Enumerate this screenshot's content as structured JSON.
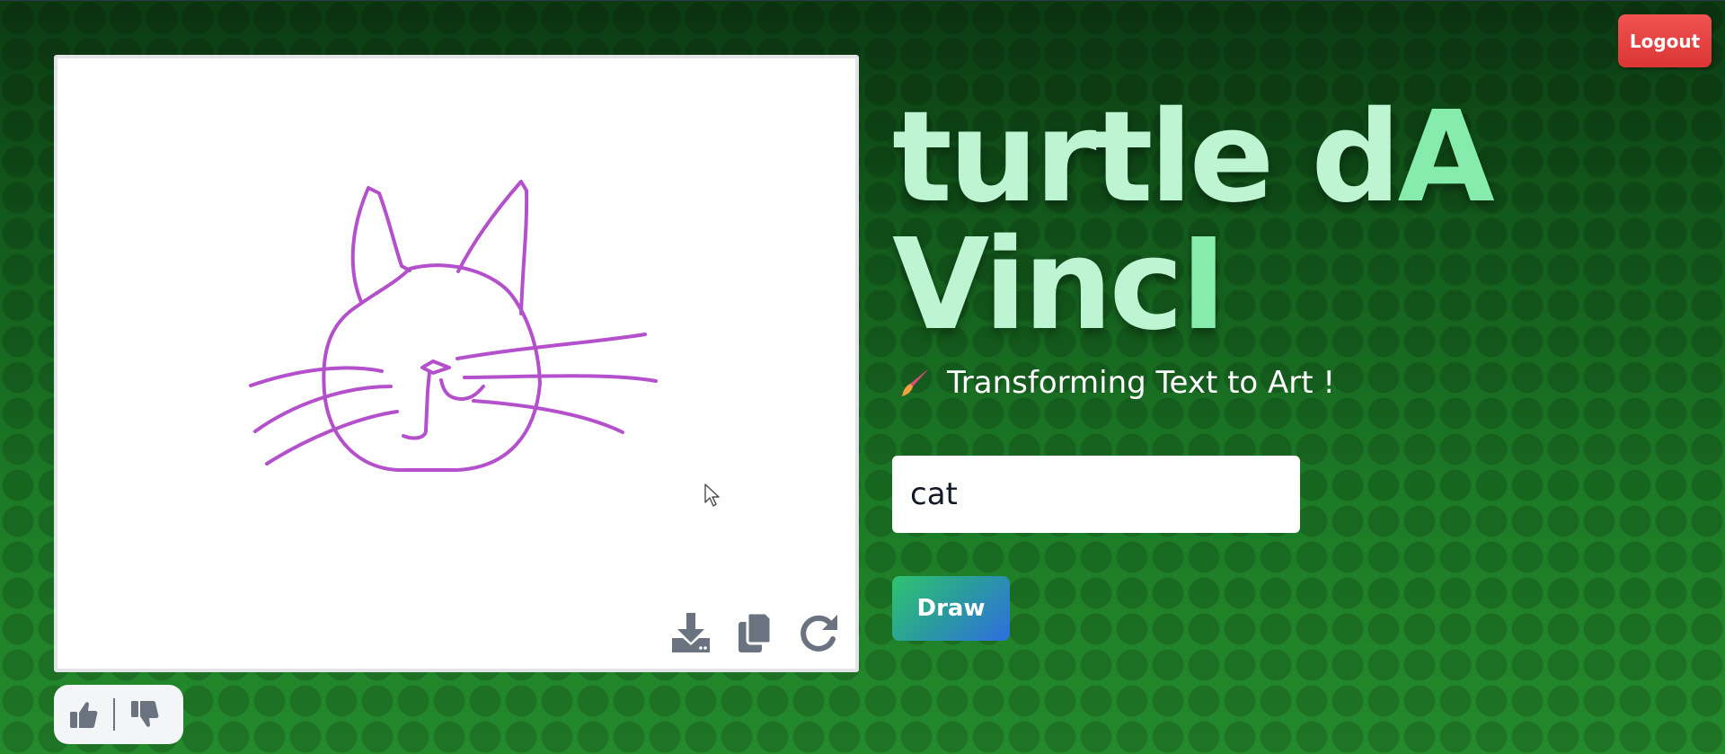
{
  "header": {
    "logout_label": "Logout"
  },
  "hero": {
    "title_line1_main": "turtle d",
    "title_line1_accent": "A",
    "title_line2_main": "Vinc",
    "title_line2_accent": "I",
    "subtitle_icon": "paintbrush-icon",
    "subtitle": "Transforming Text to Art !"
  },
  "form": {
    "prompt_value": "cat",
    "draw_label": "Draw"
  },
  "canvas": {
    "drawing_subject": "cat",
    "stroke_color": "#b450cc",
    "tools": [
      {
        "name": "download-icon"
      },
      {
        "name": "copy-icon"
      },
      {
        "name": "redo-icon"
      }
    ]
  },
  "feedback": {
    "like_icon": "thumbs-up-icon",
    "dislike_icon": "thumbs-down-icon"
  },
  "colors": {
    "logout": "#dc3535",
    "title": "#bdf5d2",
    "title_accent": "#86ecad",
    "icon_gray": "#6b7280"
  }
}
